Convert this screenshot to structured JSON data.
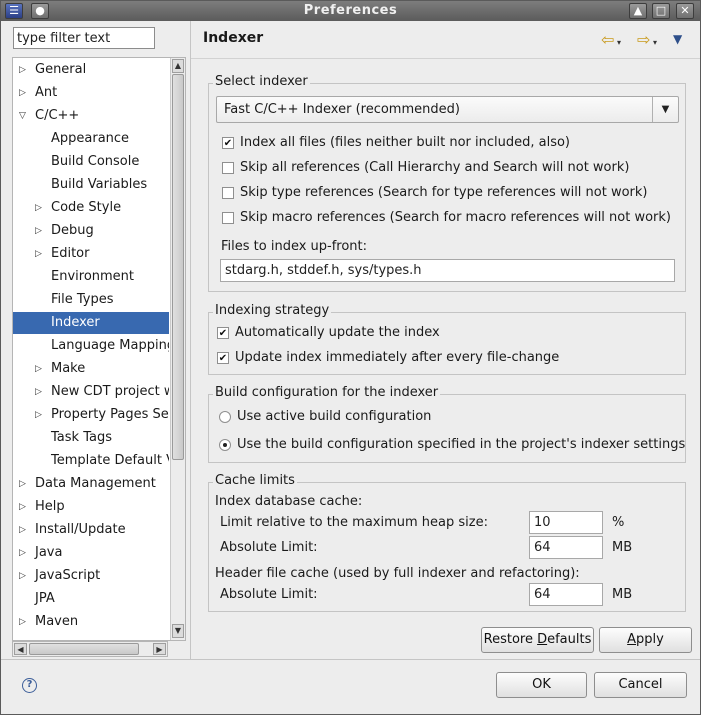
{
  "window": {
    "title": "Preferences",
    "buttons": {
      "pin": "●",
      "up": "▲",
      "restore": "□",
      "close": "✕"
    }
  },
  "filter": {
    "value": "type filter text"
  },
  "tree": {
    "items": [
      {
        "label": "General",
        "level": 0,
        "arrow": "▷"
      },
      {
        "label": "Ant",
        "level": 0,
        "arrow": "▷"
      },
      {
        "label": "C/C++",
        "level": 0,
        "arrow": "▽"
      },
      {
        "label": "Appearance",
        "level": 1,
        "arrow": ""
      },
      {
        "label": "Build Console",
        "level": 1,
        "arrow": ""
      },
      {
        "label": "Build Variables",
        "level": 1,
        "arrow": ""
      },
      {
        "label": "Code Style",
        "level": 1,
        "arrow": "▷"
      },
      {
        "label": "Debug",
        "level": 1,
        "arrow": "▷"
      },
      {
        "label": "Editor",
        "level": 1,
        "arrow": "▷"
      },
      {
        "label": "Environment",
        "level": 1,
        "arrow": ""
      },
      {
        "label": "File Types",
        "level": 1,
        "arrow": ""
      },
      {
        "label": "Indexer",
        "level": 1,
        "arrow": "",
        "selected": true
      },
      {
        "label": "Language Mappings",
        "level": 1,
        "arrow": ""
      },
      {
        "label": "Make",
        "level": 1,
        "arrow": "▷"
      },
      {
        "label": "New CDT project wizard",
        "level": 1,
        "arrow": "▷"
      },
      {
        "label": "Property Pages Settings",
        "level": 1,
        "arrow": "▷"
      },
      {
        "label": "Task Tags",
        "level": 1,
        "arrow": ""
      },
      {
        "label": "Template Default Values",
        "level": 1,
        "arrow": ""
      },
      {
        "label": "Data Management",
        "level": 0,
        "arrow": "▷"
      },
      {
        "label": "Help",
        "level": 0,
        "arrow": "▷"
      },
      {
        "label": "Install/Update",
        "level": 0,
        "arrow": "▷"
      },
      {
        "label": "Java",
        "level": 0,
        "arrow": "▷"
      },
      {
        "label": "JavaScript",
        "level": 0,
        "arrow": "▷"
      },
      {
        "label": "JPA",
        "level": 0,
        "arrow": ""
      },
      {
        "label": "Maven",
        "level": 0,
        "arrow": "▷"
      }
    ]
  },
  "page": {
    "title": "Indexer",
    "nav": {
      "back": "⇦",
      "forward": "⇨",
      "menu": "▼"
    }
  },
  "select_indexer": {
    "group_label": "Select indexer",
    "combo_value": "Fast C/C++ Indexer (recommended)",
    "options": [
      {
        "label": "Index all files (files neither built nor included, also)",
        "checked": true
      },
      {
        "label": "Skip all references (Call Hierarchy and Search will not work)",
        "checked": false
      },
      {
        "label": "Skip type references (Search for type references will not work)",
        "checked": false
      },
      {
        "label": "Skip macro references (Search for macro references will not work)",
        "checked": false
      }
    ],
    "upfront_label": "Files to index up-front:",
    "upfront_value": "stdarg.h, stddef.h, sys/types.h"
  },
  "indexing_strategy": {
    "group_label": "Indexing strategy",
    "options": [
      {
        "label": "Automatically update the index",
        "checked": true
      },
      {
        "label": "Update index immediately after every file-change",
        "checked": true
      }
    ]
  },
  "build_config": {
    "group_label": "Build configuration for the indexer",
    "options": [
      {
        "label": "Use active build configuration",
        "selected": false
      },
      {
        "label": "Use the build configuration specified in the project's indexer settings",
        "selected": true
      }
    ]
  },
  "cache_limits": {
    "group_label": "Cache limits",
    "index_db_label": "Index database cache:",
    "relative_label": "Limit relative to the maximum heap size:",
    "relative_value": "10",
    "relative_unit": "%",
    "absolute_label": "Absolute Limit:",
    "absolute_value": "64",
    "absolute_unit": "MB",
    "header_label": "Header file cache (used by full indexer and refactoring):",
    "header_absolute_label": "Absolute Limit:",
    "header_absolute_value": "64",
    "header_absolute_unit": "MB"
  },
  "buttons": {
    "restore_defaults": "Restore Defaults",
    "apply": "Apply",
    "ok": "OK",
    "cancel": "Cancel",
    "help": "?"
  },
  "scroll_glyphs": {
    "up": "▲",
    "down": "▼",
    "left": "◀",
    "right": "▶"
  }
}
